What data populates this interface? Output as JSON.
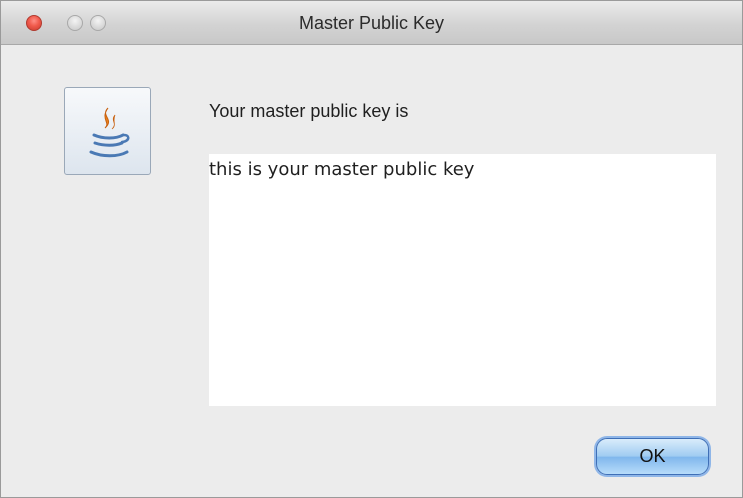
{
  "window": {
    "title": "Master Public Key"
  },
  "dialog": {
    "icon": "java-icon",
    "message": "Your master public key is",
    "key_text": "this is your master public key",
    "ok_label": "OK"
  },
  "colors": {
    "close_button": "#f05a4c",
    "ok_button": "#9fcbf1",
    "background": "#ececec"
  }
}
